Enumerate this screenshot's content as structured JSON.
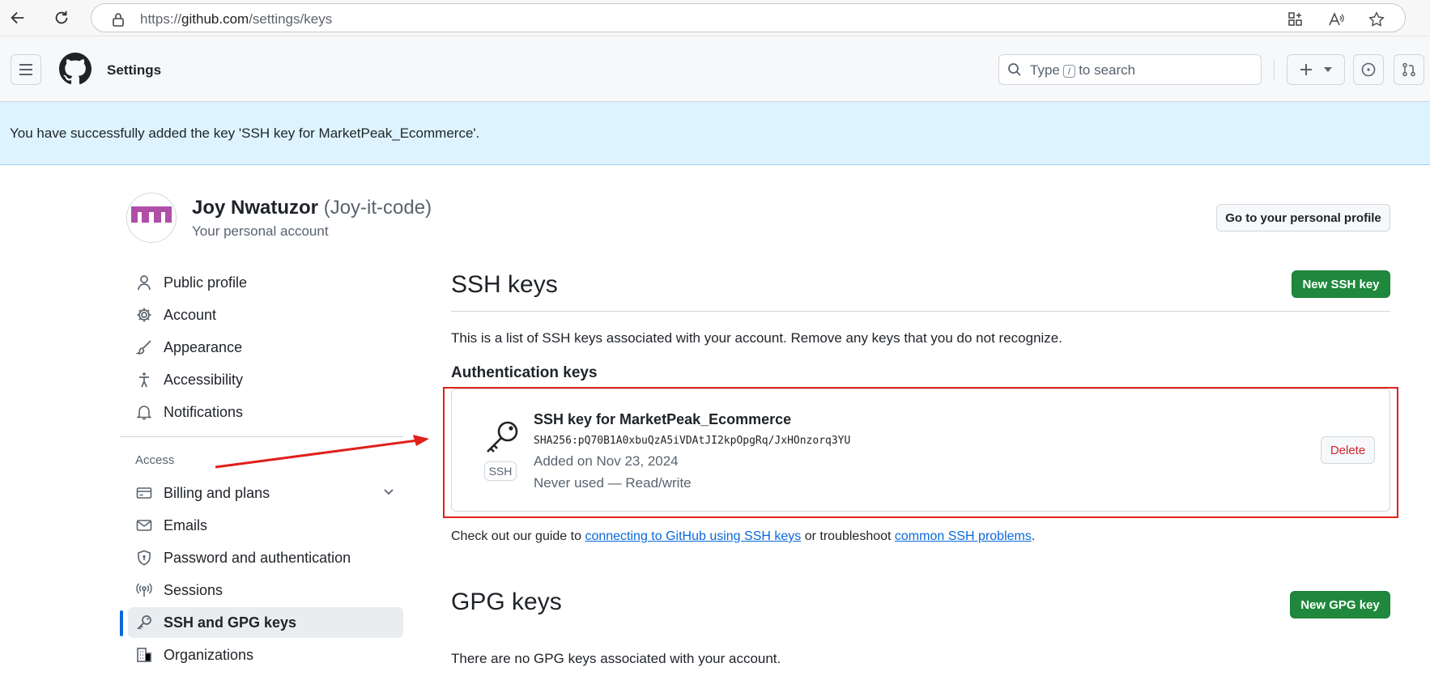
{
  "browser": {
    "url_prefix": "https://",
    "url_host": "github.com",
    "url_path": "/settings/keys"
  },
  "header": {
    "title": "Settings",
    "search_prefix": "Type",
    "search_key": "/",
    "search_suffix": "to search"
  },
  "flash": {
    "message": "You have successfully added the key 'SSH key for MarketPeak_Ecommerce'."
  },
  "profile": {
    "name": "Joy Nwatuzor",
    "login": "(Joy-it-code)",
    "subtitle": "Your personal account",
    "profile_button": "Go to your personal profile"
  },
  "sidebar": {
    "items": [
      {
        "label": "Public profile",
        "icon": "person-icon"
      },
      {
        "label": "Account",
        "icon": "gear-icon"
      },
      {
        "label": "Appearance",
        "icon": "paintbrush-icon"
      },
      {
        "label": "Accessibility",
        "icon": "accessibility-icon"
      },
      {
        "label": "Notifications",
        "icon": "bell-icon"
      }
    ],
    "access_heading": "Access",
    "access_items": [
      {
        "label": "Billing and plans",
        "icon": "credit-card-icon"
      },
      {
        "label": "Emails",
        "icon": "mail-icon"
      },
      {
        "label": "Password and authentication",
        "icon": "shield-lock-icon"
      },
      {
        "label": "Sessions",
        "icon": "broadcast-icon"
      },
      {
        "label": "SSH and GPG keys",
        "icon": "key-icon",
        "active": true
      },
      {
        "label": "Organizations",
        "icon": "organization-icon"
      }
    ]
  },
  "ssh": {
    "title": "SSH keys",
    "new_button": "New SSH key",
    "description": "This is a list of SSH keys associated with your account. Remove any keys that you do not recognize.",
    "auth_heading": "Authentication keys",
    "key": {
      "title": "SSH key for MarketPeak_Ecommerce",
      "fingerprint": "SHA256:pQ70B1A0xbuQzA5iVDAtJI2kpOpgRq/JxHOnzorq3YU",
      "added": "Added on Nov 23, 2024",
      "usage": "Never used — Read/write",
      "type_label": "SSH",
      "delete_button": "Delete"
    },
    "guide_prefix": "Check out our guide to",
    "guide_link1": "connecting to GitHub using SSH keys",
    "guide_middle": "or troubleshoot",
    "guide_link2": "common SSH problems",
    "guide_suffix": "."
  },
  "gpg": {
    "title": "GPG keys",
    "new_button": "New GPG key",
    "empty_text": "There are no GPG keys associated with your account."
  },
  "colors": {
    "primary_button": "#1f883d",
    "flash_background": "#ddf4ff",
    "link": "#0969da",
    "danger": "#d1242f",
    "highlight": "#e0201c",
    "active_indicator": "#0969da"
  }
}
